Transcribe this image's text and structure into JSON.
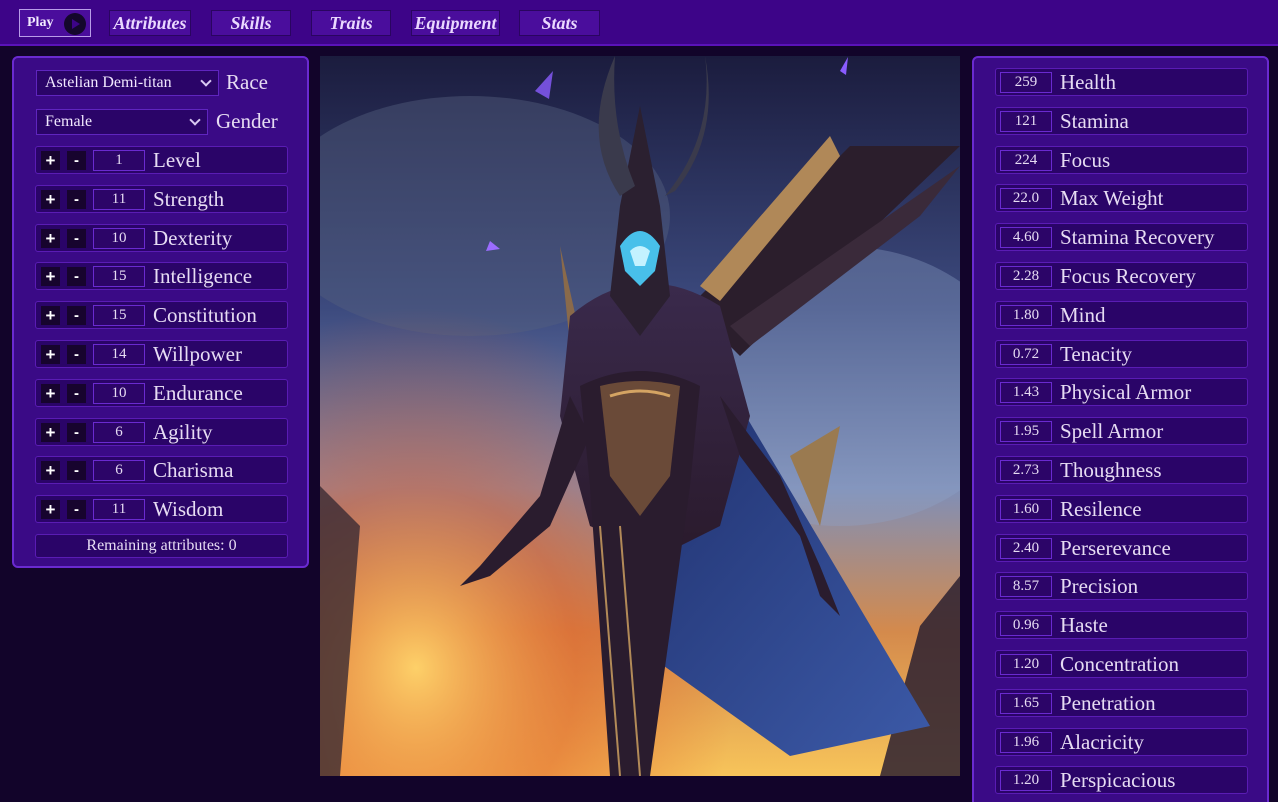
{
  "nav": {
    "play_label": "Play",
    "tabs": [
      "Attributes",
      "Skills",
      "Traits",
      "Equipment",
      "Stats"
    ]
  },
  "character": {
    "race": {
      "value": "Astelian Demi-titan",
      "label": "Race"
    },
    "gender": {
      "value": "Female",
      "label": "Gender"
    }
  },
  "attributes": [
    {
      "name": "Level",
      "value": "1"
    },
    {
      "name": "Strength",
      "value": "11"
    },
    {
      "name": "Dexterity",
      "value": "10"
    },
    {
      "name": "Intelligence",
      "value": "15"
    },
    {
      "name": "Constitution",
      "value": "15"
    },
    {
      "name": "Willpower",
      "value": "14"
    },
    {
      "name": "Endurance",
      "value": "10"
    },
    {
      "name": "Agility",
      "value": "6"
    },
    {
      "name": "Charisma",
      "value": "6"
    },
    {
      "name": "Wisdom",
      "value": "11"
    }
  ],
  "controls": {
    "plus": "+",
    "minus": "-"
  },
  "remaining": "Remaining attributes: 0",
  "stats": [
    {
      "name": "Health",
      "value": "259"
    },
    {
      "name": "Stamina",
      "value": "121"
    },
    {
      "name": "Focus",
      "value": "224"
    },
    {
      "name": "Max Weight",
      "value": "22.0"
    },
    {
      "name": "Stamina Recovery",
      "value": "4.60"
    },
    {
      "name": "Focus Recovery",
      "value": "2.28"
    },
    {
      "name": "Mind",
      "value": "1.80"
    },
    {
      "name": "Tenacity",
      "value": "0.72"
    },
    {
      "name": "Physical Armor",
      "value": "1.43"
    },
    {
      "name": "Spell Armor",
      "value": "1.95"
    },
    {
      "name": "Thoughness",
      "value": "2.73"
    },
    {
      "name": "Resilence",
      "value": "1.60"
    },
    {
      "name": "Perserevance",
      "value": "2.40"
    },
    {
      "name": "Precision",
      "value": "8.57"
    },
    {
      "name": "Haste",
      "value": "0.96"
    },
    {
      "name": "Concentration",
      "value": "1.20"
    },
    {
      "name": "Penetration",
      "value": "1.65"
    },
    {
      "name": "Alacricity",
      "value": "1.96"
    },
    {
      "name": "Perspicacious",
      "value": "1.20"
    }
  ],
  "colors": {
    "background": "#12042a",
    "nav_bar": "#3d0488",
    "panel": "#3a0a86",
    "row": "#2a0468",
    "accent": "#6a2ad0"
  }
}
